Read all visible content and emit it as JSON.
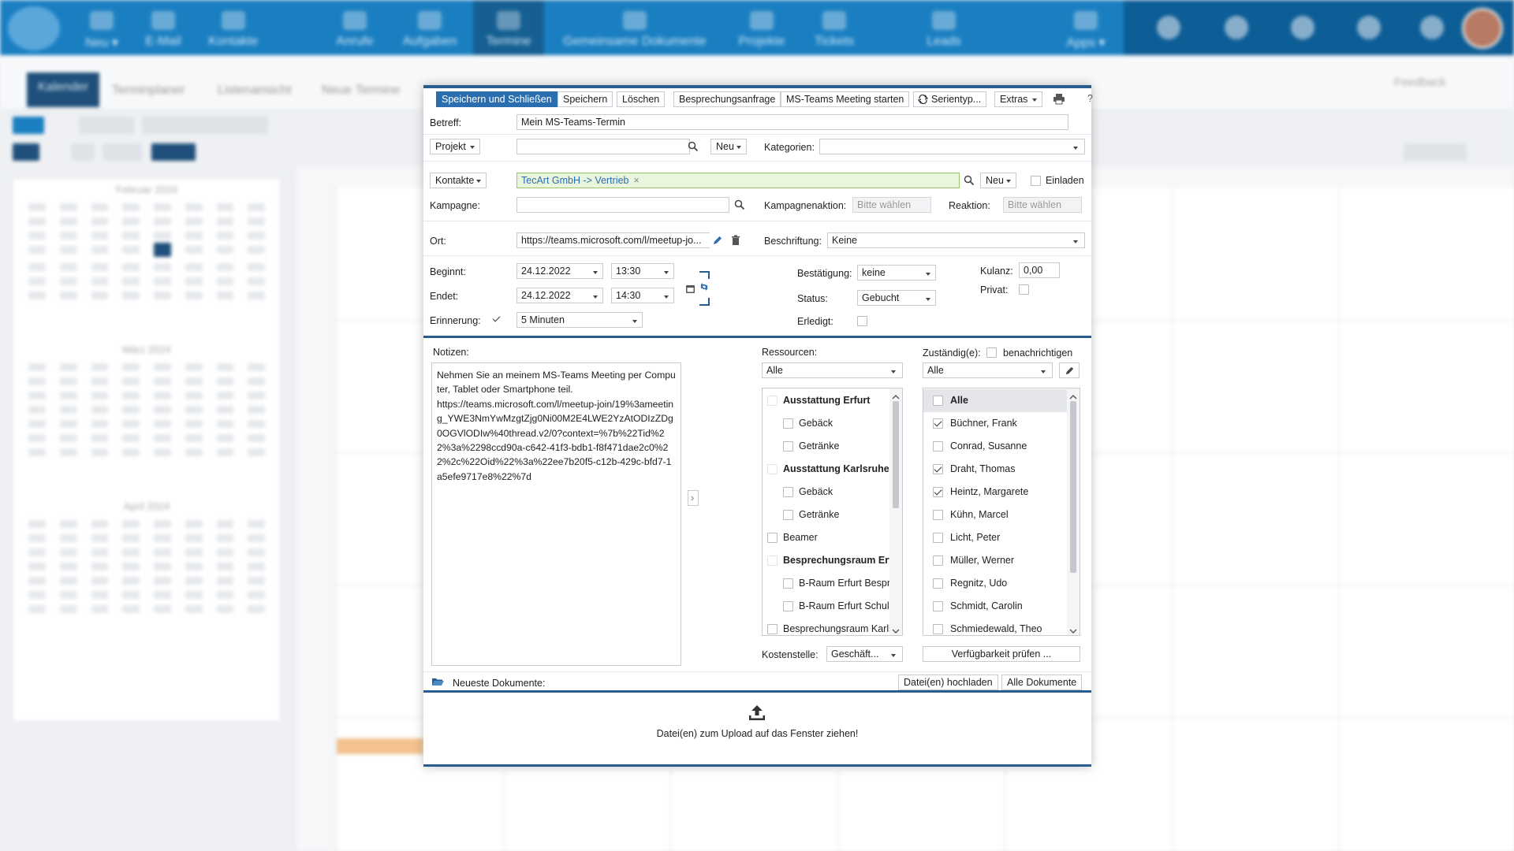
{
  "bg": {
    "nav": [
      "Neu ▾",
      "E-Mail",
      "Kontakte",
      "Anrufe",
      "Aufgaben",
      "Termine",
      "Gemeinsame Dokumente",
      "Projekte",
      "Tickets",
      "Leads",
      "Apps ▾"
    ],
    "subtabs": [
      "Kalender",
      "Terminplaner",
      "Listenansicht",
      "Neue Termine"
    ],
    "months": [
      "Februar 2024",
      "März 2024",
      "April 2024"
    ],
    "feedback": "Feedback"
  },
  "toolbar": {
    "save_close": "Speichern und Schließen",
    "save": "Speichern",
    "delete": "Löschen",
    "meeting_request": "Besprechungsanfrage",
    "teams": "MS-Teams Meeting starten",
    "series": "Serientyp...",
    "extras": "Extras"
  },
  "form": {
    "subject_label": "Betreff:",
    "subject_value": "Mein MS-Teams-Termin",
    "project_label": "Projekt",
    "new_label": "Neu",
    "categories_label": "Kategorien:",
    "contacts_label": "Kontakte",
    "contact_tag": "TecArt GmbH -> Vertrieb",
    "invite_label": "Einladen",
    "campaign_label": "Kampagne:",
    "campaign_action_label": "Kampagnenaktion:",
    "campaign_action_value": "Bitte wählen",
    "reaction_label": "Reaktion:",
    "reaction_value": "Bitte wählen",
    "location_label": "Ort:",
    "location_value": "https://teams.microsoft.com/l/meetup-jo...",
    "caption_label": "Beschriftung:",
    "caption_value": "Keine",
    "start_label": "Beginnt:",
    "start_date": "24.12.2022",
    "start_time": "13:30",
    "end_label": "Endet:",
    "end_date": "24.12.2022",
    "end_time": "14:30",
    "reminder_label": "Erinnerung:",
    "reminder_value": "5 Minuten",
    "confirm_label": "Bestätigung:",
    "confirm_value": "keine",
    "status_label": "Status:",
    "status_value": "Gebucht",
    "done_label": "Erledigt:",
    "goodwill_label": "Kulanz:",
    "goodwill_value": "0,00",
    "private_label": "Privat:"
  },
  "notes": {
    "label": "Notizen:",
    "text": "Nehmen Sie an meinem MS-Teams Meeting per Computer, Tablet oder Smartphone teil.\nhttps://teams.microsoft.com/l/meetup-join/19%3ameeting_YWE3NmYwMzgtZjg0Ni00M2E4LWE2YzAtODIzZDg0OGVlODIw%40thread.v2/0?context=%7b%22Tid%22%3a%2298ccd90a-c642-41f3-bdb1-f8f471dae2c0%22%2c%22Oid%22%3a%22ee7b20f5-c12b-429c-bfd7-1a5efe9717e8%22%7d"
  },
  "resources": {
    "label": "Ressourcen:",
    "filter": "Alle",
    "items": [
      {
        "label": "Ausstattung Erfurt",
        "bold": true
      },
      {
        "label": "Gebäck",
        "indent": true
      },
      {
        "label": "Getränke",
        "indent": true
      },
      {
        "label": "Ausstattung Karlsruhe",
        "bold": true
      },
      {
        "label": "Gebäck",
        "indent": true
      },
      {
        "label": "Getränke",
        "indent": true
      },
      {
        "label": "Beamer"
      },
      {
        "label": "Besprechungsraum Erfu",
        "bold": true
      },
      {
        "label": "B-Raum Erfurt Bespre",
        "indent": true
      },
      {
        "label": "B-Raum Erfurt Schulu",
        "indent": true
      },
      {
        "label": "Besprechungsraum Karls"
      }
    ],
    "cost_center_label": "Kostenstelle:",
    "cost_center_value": "Geschäft..."
  },
  "responsible": {
    "label": "Zuständig(e):",
    "notify_label": "benachrichtigen",
    "filter": "Alle",
    "items": [
      {
        "label": "Alle",
        "checked": false,
        "bold": true
      },
      {
        "label": "Büchner, Frank",
        "checked": true
      },
      {
        "label": "Conrad, Susanne",
        "checked": false
      },
      {
        "label": "Draht, Thomas",
        "checked": true
      },
      {
        "label": "Heintz, Margarete",
        "checked": true
      },
      {
        "label": "Kühn, Marcel",
        "checked": false
      },
      {
        "label": "Licht, Peter",
        "checked": false
      },
      {
        "label": "Müller, Werner",
        "checked": false
      },
      {
        "label": "Regnitz, Udo",
        "checked": false
      },
      {
        "label": "Schmidt, Carolin",
        "checked": false
      },
      {
        "label": "Schmiedewald, Theo",
        "checked": false
      }
    ],
    "availability_button": "Verfügbarkeit prüfen ..."
  },
  "documents": {
    "label": "Neueste Dokumente:",
    "upload_button": "Datei(en) hochladen",
    "all_button": "Alle Dokumente",
    "drop_text": "Datei(en) zum Upload auf das Fenster ziehen!"
  }
}
